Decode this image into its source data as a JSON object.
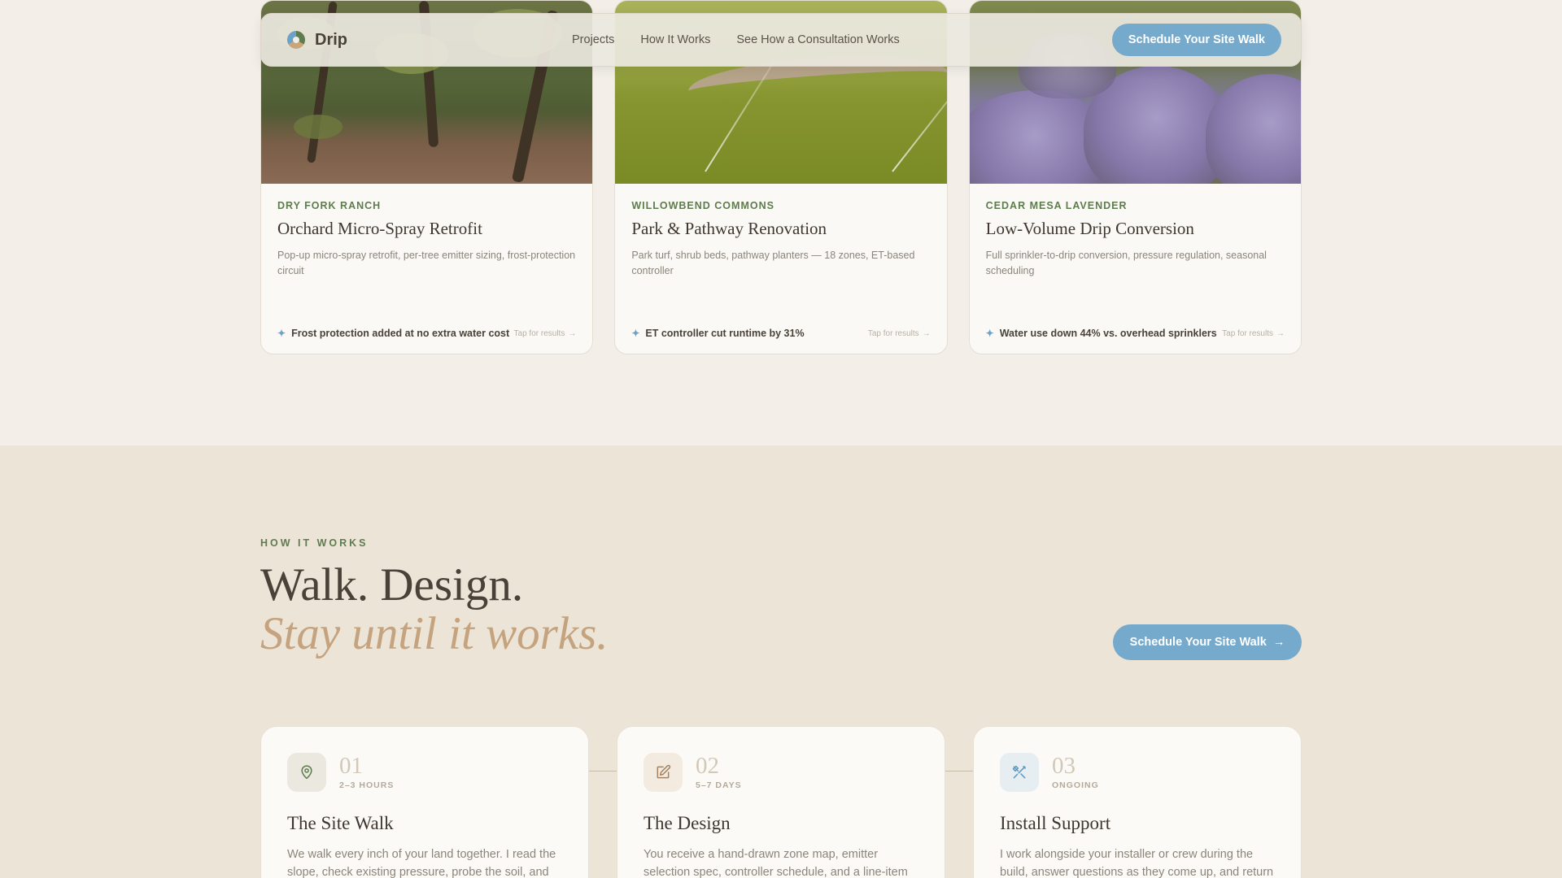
{
  "nav": {
    "brand": "Drip",
    "links": [
      "Projects",
      "How It Works",
      "See How a Consultation Works"
    ],
    "cta": "Schedule Your Site Walk"
  },
  "projects": [
    {
      "client": "DRY FORK RANCH",
      "title": "Orchard Micro-Spray Retrofit",
      "desc": "Pop-up micro-spray retrofit, per-tree emitter sizing, frost-protection circuit",
      "result": "Frost protection added at no extra water cost",
      "tap": "Tap for results"
    },
    {
      "client": "WILLOWBEND COMMONS",
      "title": "Park & Pathway Renovation",
      "desc": "Park turf, shrub beds, pathway planters — 18 zones, ET-based controller",
      "result": "ET controller cut runtime by 31%",
      "tap": "Tap for results"
    },
    {
      "client": "CEDAR MESA LAVENDER",
      "title": "Low-Volume Drip Conversion",
      "desc": "Full sprinkler-to-drip conversion, pressure regulation, seasonal scheduling",
      "result": "Water use down 44% vs. overhead sprinklers",
      "tap": "Tap for results"
    }
  ],
  "how": {
    "eyebrow": "HOW IT WORKS",
    "headline_1": "Walk. Design.",
    "headline_2": "Stay until it works.",
    "cta": "Schedule Your Site Walk",
    "steps": [
      {
        "num": "01",
        "duration": "2–3 HOURS",
        "title": "The Site Walk",
        "desc": "We walk every inch of your land together. I read the slope, check existing pressure, probe the soil, and",
        "icon": "map-pin-icon"
      },
      {
        "num": "02",
        "duration": "5–7 DAYS",
        "title": "The Design",
        "desc": "You receive a hand-drawn zone map, emitter selection spec, controller schedule, and a line-item materials",
        "icon": "pencil-edit-icon"
      },
      {
        "num": "03",
        "duration": "ONGOING",
        "title": "Install Support",
        "desc": "I work alongside your installer or crew during the build, answer questions as they come up, and return for a",
        "icon": "tools-icon"
      }
    ]
  },
  "colors": {
    "accent_blue": "#75aacd",
    "brand_green": "#5e7c4e",
    "tan": "#c4a37e"
  }
}
